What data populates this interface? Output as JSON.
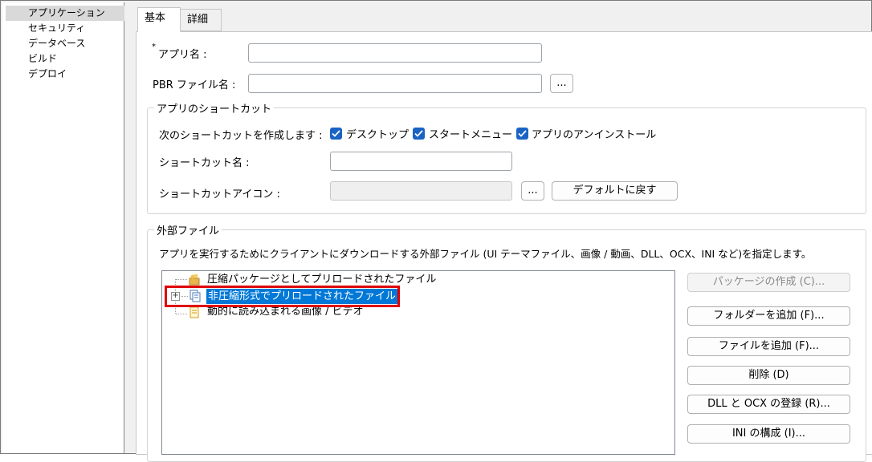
{
  "nav": {
    "items": [
      {
        "label": "アプリケーション",
        "selected": true
      },
      {
        "label": "セキュリティ",
        "selected": false
      },
      {
        "label": "データベース",
        "selected": false
      },
      {
        "label": "ビルド",
        "selected": false
      },
      {
        "label": "デプロイ",
        "selected": false
      }
    ]
  },
  "tabs": [
    {
      "label": "基本",
      "active": true
    },
    {
      "label": "詳細",
      "active": false
    }
  ],
  "form": {
    "app_name_label": "アプリ名 :",
    "app_name_required_mark": "*",
    "app_name_value": "",
    "pbr_label": "PBR ファイル名 :",
    "pbr_value": "",
    "browse_label": "..."
  },
  "shortcut": {
    "group_title": "アプリのショートカット",
    "create_label": "次のショートカットを作成します :",
    "checkboxes": [
      {
        "label": "デスクトップ",
        "checked": true
      },
      {
        "label": "スタートメニュー",
        "checked": true
      },
      {
        "label": "アプリのアンインストール",
        "checked": true
      }
    ],
    "name_label": "ショートカット名 :",
    "name_value": "",
    "icon_label": "ショートカットアイコン :",
    "icon_browse_label": "...",
    "reset_label": "デフォルトに戻す"
  },
  "external": {
    "group_title": "外部ファイル",
    "description": "アプリを実行するためにクライアントにダウンロードする外部ファイル (UI テーマファイル、画像 / 動画、DLL、OCX、INI など)を指定します。",
    "tree": [
      {
        "label": "圧縮パッケージとしてプリロードされたファイル",
        "icon": "package-icon",
        "expandable": false,
        "selected": false
      },
      {
        "label": "非圧縮形式でプリロードされたファイル",
        "icon": "files-icon",
        "expandable": true,
        "selected": true
      },
      {
        "label": "動的に読み込まれる画像 / ビデオ",
        "icon": "document-icon",
        "expandable": false,
        "selected": false
      }
    ],
    "buttons": [
      {
        "label": "パッケージの作成 (C)...",
        "enabled": false
      },
      {
        "label": "フォルダーを追加 (F)...",
        "enabled": true
      },
      {
        "label": "ファイルを追加 (F)...",
        "enabled": true
      },
      {
        "label": "削除 (D)",
        "enabled": true
      },
      {
        "label": "DLL と OCX の登録 (R)...",
        "enabled": true
      },
      {
        "label": "INI の構成 (I)...",
        "enabled": true
      }
    ]
  },
  "colors": {
    "checkbox": "#1a63c4",
    "selection": "#0078d7",
    "highlight_box": "#e00000"
  }
}
